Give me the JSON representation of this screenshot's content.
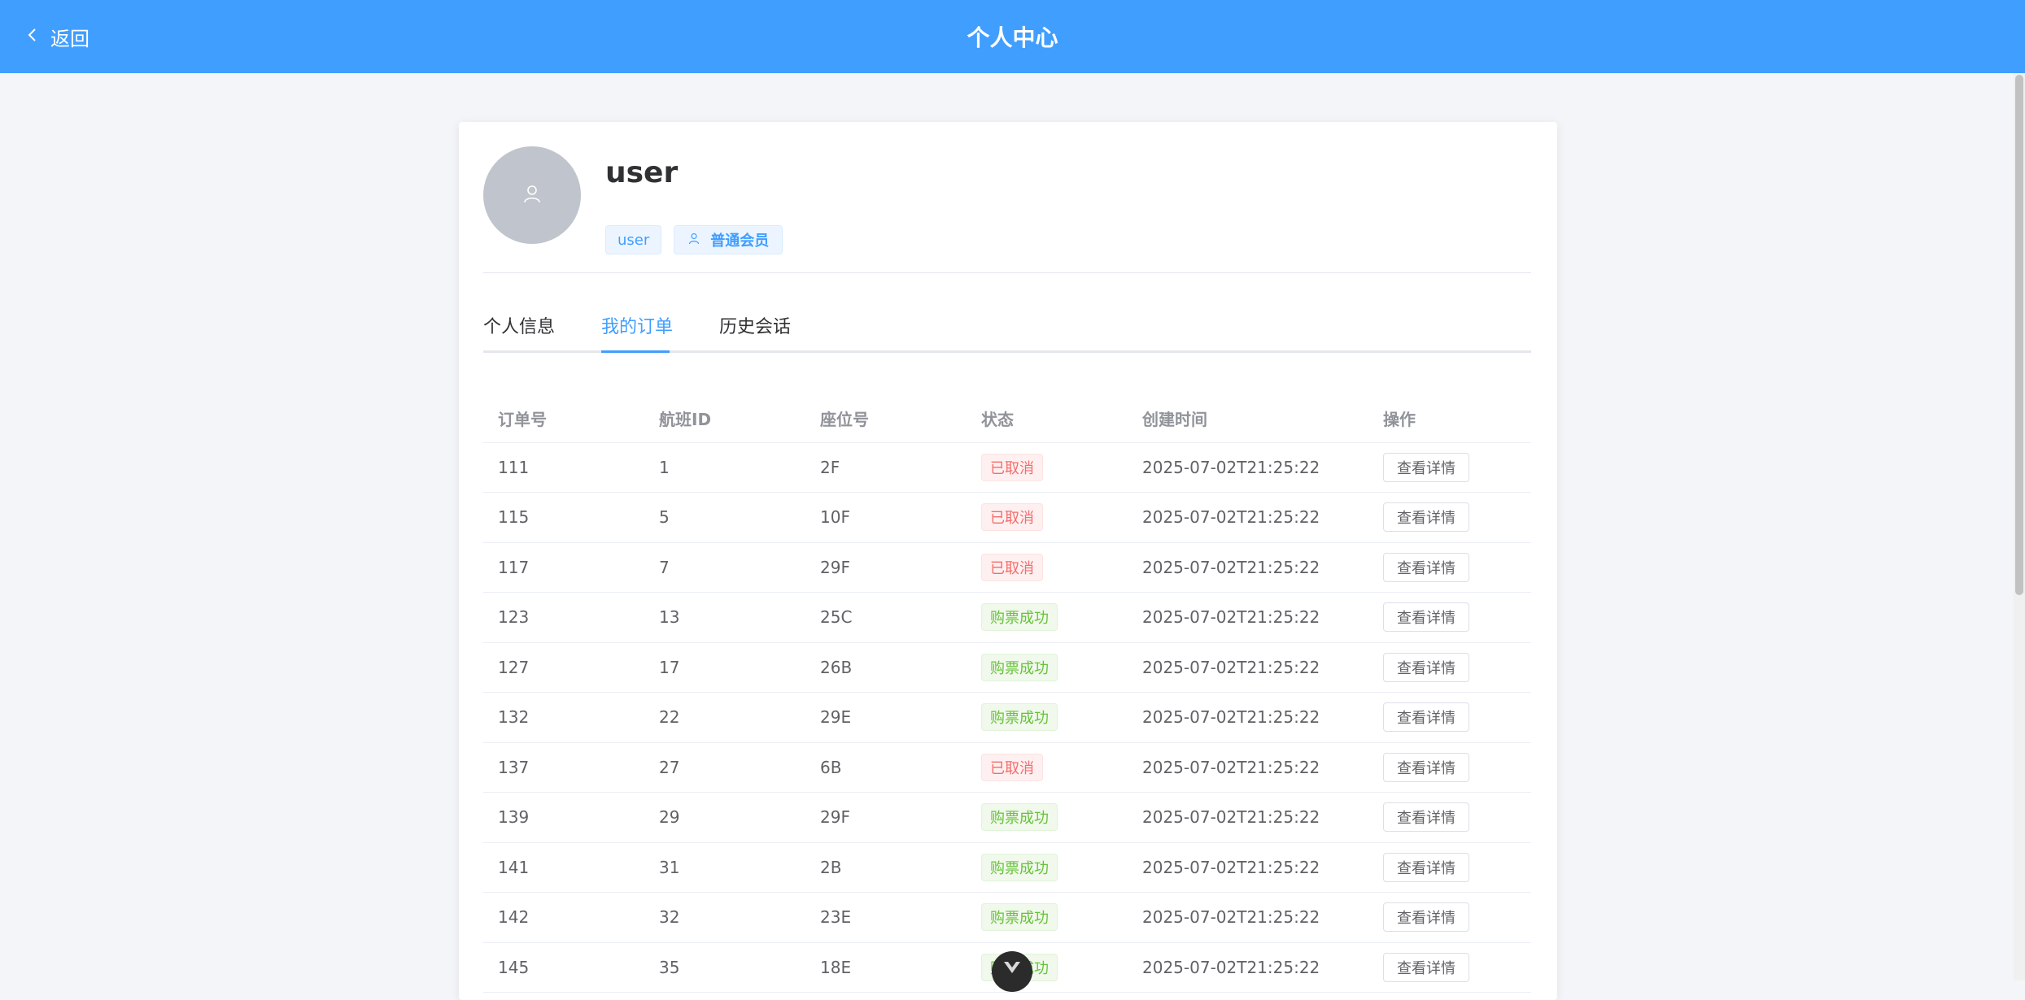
{
  "header": {
    "back_label": "返回",
    "title": "个人中心"
  },
  "profile": {
    "username": "user",
    "role_tag": "user",
    "member_tag": "普通会员"
  },
  "tabs": [
    {
      "label": "个人信息"
    },
    {
      "label": "我的订单"
    },
    {
      "label": "历史会话"
    }
  ],
  "active_tab": "我的订单",
  "table": {
    "columns": [
      "订单号",
      "航班ID",
      "座位号",
      "状态",
      "创建时间",
      "操作"
    ],
    "rows": [
      {
        "order_no": "111",
        "flight_id": "1",
        "seat": "2F",
        "status": "已取消",
        "created": "2025-07-02T21:25:22",
        "action": "查看详情"
      },
      {
        "order_no": "115",
        "flight_id": "5",
        "seat": "10F",
        "status": "已取消",
        "created": "2025-07-02T21:25:22",
        "action": "查看详情"
      },
      {
        "order_no": "117",
        "flight_id": "7",
        "seat": "29F",
        "status": "已取消",
        "created": "2025-07-02T21:25:22",
        "action": "查看详情"
      },
      {
        "order_no": "123",
        "flight_id": "13",
        "seat": "25C",
        "status": "购票成功",
        "created": "2025-07-02T21:25:22",
        "action": "查看详情"
      },
      {
        "order_no": "127",
        "flight_id": "17",
        "seat": "26B",
        "status": "购票成功",
        "created": "2025-07-02T21:25:22",
        "action": "查看详情"
      },
      {
        "order_no": "132",
        "flight_id": "22",
        "seat": "29E",
        "status": "购票成功",
        "created": "2025-07-02T21:25:22",
        "action": "查看详情"
      },
      {
        "order_no": "137",
        "flight_id": "27",
        "seat": "6B",
        "status": "已取消",
        "created": "2025-07-02T21:25:22",
        "action": "查看详情"
      },
      {
        "order_no": "139",
        "flight_id": "29",
        "seat": "29F",
        "status": "购票成功",
        "created": "2025-07-02T21:25:22",
        "action": "查看详情"
      },
      {
        "order_no": "141",
        "flight_id": "31",
        "seat": "2B",
        "status": "购票成功",
        "created": "2025-07-02T21:25:22",
        "action": "查看详情"
      },
      {
        "order_no": "142",
        "flight_id": "32",
        "seat": "23E",
        "status": "购票成功",
        "created": "2025-07-02T21:25:22",
        "action": "查看详情"
      },
      {
        "order_no": "145",
        "flight_id": "35",
        "seat": "18E",
        "status": "购票成功",
        "created": "2025-07-02T21:25:22",
        "action": "查看详情"
      }
    ]
  },
  "colors": {
    "primary": "#409eff",
    "cancel_text": "#f56c6c",
    "success_text": "#67c23a"
  },
  "icons": {
    "back": "chevron-left-icon",
    "avatar": "user-icon",
    "member": "user-icon",
    "float": "vue-logo-icon"
  }
}
